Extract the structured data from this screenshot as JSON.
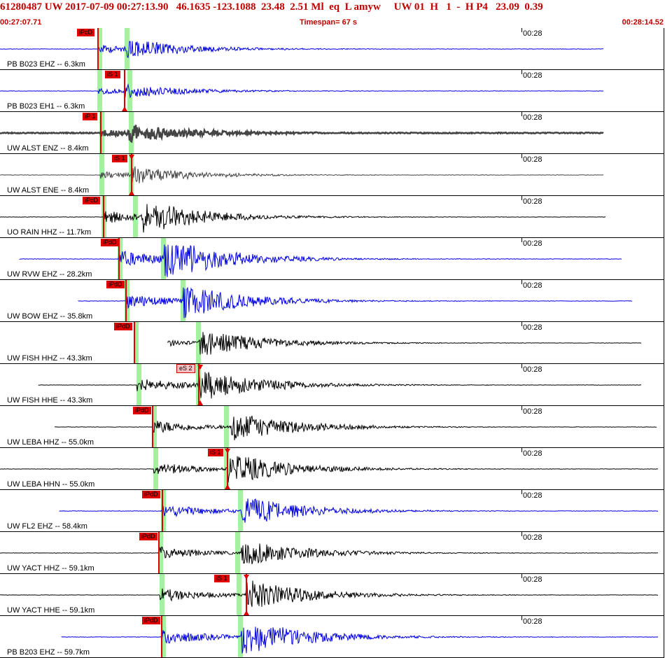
{
  "header": {
    "title": "61280487 UW 2017-07-09 00:27:13.90   46.1635 -123.1088  23.48  2.51 Ml  eq  L amyw     UW 01  H   1  -  H P4   23.09  0.39",
    "start_time": "00:27:07.71",
    "timespan": "Timespan=  67 s",
    "end_time": "00:28:14.52"
  },
  "tick_label": "00:28",
  "colors": {
    "blue": "#0000e0",
    "black": "#000000",
    "gray": "#444444",
    "pick": "#e00000",
    "green": "#a4f2a0",
    "title": "#c00000"
  },
  "channels": [
    {
      "label": "PB B023 EHZ -- 6.3km",
      "pick": "iPcD",
      "s_pick": ""
    },
    {
      "label": "PB B023 EH1 -- 6.3km",
      "pick": "iS 1",
      "s_pick": ""
    },
    {
      "label": "UW ALST ENZ -- 8.4km",
      "pick": "iP 1",
      "s_pick": ""
    },
    {
      "label": "UW ALST ENE -- 8.4km",
      "pick": "iS 1",
      "s_pick": ""
    },
    {
      "label": "UO RAIN HHZ -- 11.7km",
      "pick": "iPcD",
      "s_pick": ""
    },
    {
      "label": "UW RVW EHZ -- 28.2km",
      "pick": "iPdD",
      "s_pick": ""
    },
    {
      "label": "UW BOW EHZ -- 35.8km",
      "pick": "iPdD",
      "s_pick": ""
    },
    {
      "label": "UW FISH HHZ -- 43.3km",
      "pick": "iPdD",
      "s_pick": ""
    },
    {
      "label": "UW FISH HHE -- 43.3km",
      "pick": "",
      "s_pick": "eS 2"
    },
    {
      "label": "UW LEBA HHZ -- 55.0km",
      "pick": "iPdD",
      "s_pick": ""
    },
    {
      "label": "UW LEBA HHN -- 55.0km",
      "pick": "iS 1",
      "s_pick": ""
    },
    {
      "label": "UW FL2 EHZ -- 58.4km",
      "pick": "iPdD",
      "s_pick": ""
    },
    {
      "label": "UW YACT HHZ -- 59.1km",
      "pick": "iPdD",
      "s_pick": ""
    },
    {
      "label": "UW YACT HHE -- 59.1km",
      "pick": "iS 1",
      "s_pick": ""
    },
    {
      "label": "PB B203 EHZ -- 59.7km",
      "pick": "iPdD",
      "s_pick": ""
    }
  ]
}
